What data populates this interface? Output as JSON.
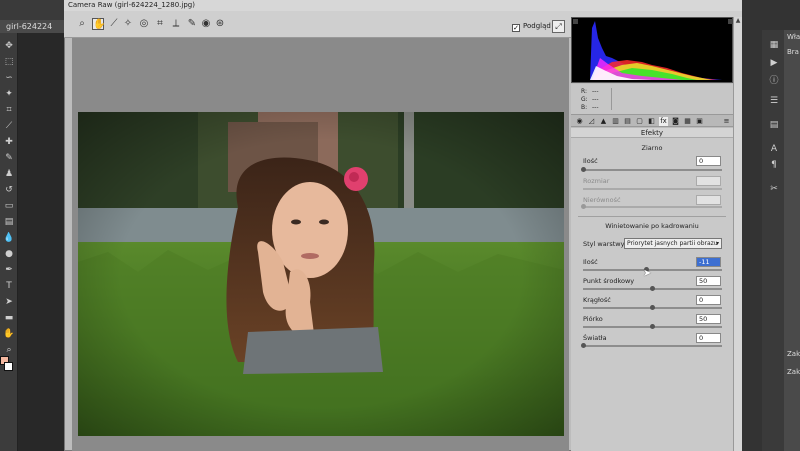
{
  "photoshop": {
    "document_tab": "girl-624224",
    "right_panel_texts": [
      "Wła",
      "Bra",
      "Zak",
      "Zak"
    ]
  },
  "camera_raw": {
    "title": "Camera Raw (girl-624224_1280.jpg)",
    "preview_label": "Podgląd",
    "preview_checked": true,
    "histogram": {
      "r_label": "R:",
      "r_value": "---",
      "g_label": "G:",
      "g_value": "---",
      "b_label": "B:",
      "b_value": "---"
    },
    "panel_title": "Efekty",
    "grain": {
      "section_title": "Ziarno",
      "amount_label": "Ilość",
      "amount_value": "0",
      "size_label": "Rozmiar",
      "size_value": "",
      "roughness_label": "Nierówność",
      "roughness_value": ""
    },
    "vignette": {
      "section_title": "Winietowanie po kadrowaniu",
      "style_label": "Styl warstwy:",
      "style_value": "Priorytet jasnych partii obrazu",
      "amount_label": "Ilość",
      "amount_value": "-11",
      "amount_level": 0.46,
      "midpoint_label": "Punkt środkowy",
      "midpoint_value": "50",
      "midpoint_level": 0.5,
      "roundness_label": "Krągłość",
      "roundness_value": "0",
      "roundness_level": 0.5,
      "feather_label": "Piórko",
      "feather_value": "50",
      "feather_level": 0.5,
      "highlights_label": "Światła",
      "highlights_value": "0",
      "highlights_level": 0
    }
  },
  "colors": {
    "accent_selected": "#3d6fd1",
    "flower": "#e0406e"
  }
}
